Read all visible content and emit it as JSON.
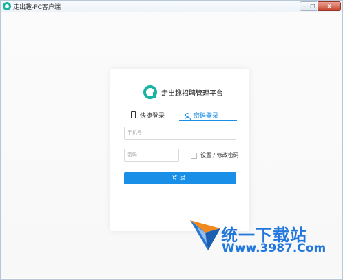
{
  "window": {
    "title": "走出趣-PC客户端"
  },
  "controls": {
    "minimize": "–",
    "maximize": "□",
    "close": "x"
  },
  "brand": {
    "title": "走出趣招聘管理平台"
  },
  "tabs": [
    {
      "label": "快捷登录"
    },
    {
      "label": "密码登录"
    }
  ],
  "form": {
    "phone_placeholder": "手机号",
    "password_placeholder": "密码",
    "checkbox_label": "设置 / 修改密码",
    "login_label": "登录"
  },
  "watermark": {
    "line1": "统一下载站",
    "line2": "Www.3987.Com"
  },
  "colors": {
    "accent": "#1a8fe8",
    "logo": "#19b3a1"
  }
}
